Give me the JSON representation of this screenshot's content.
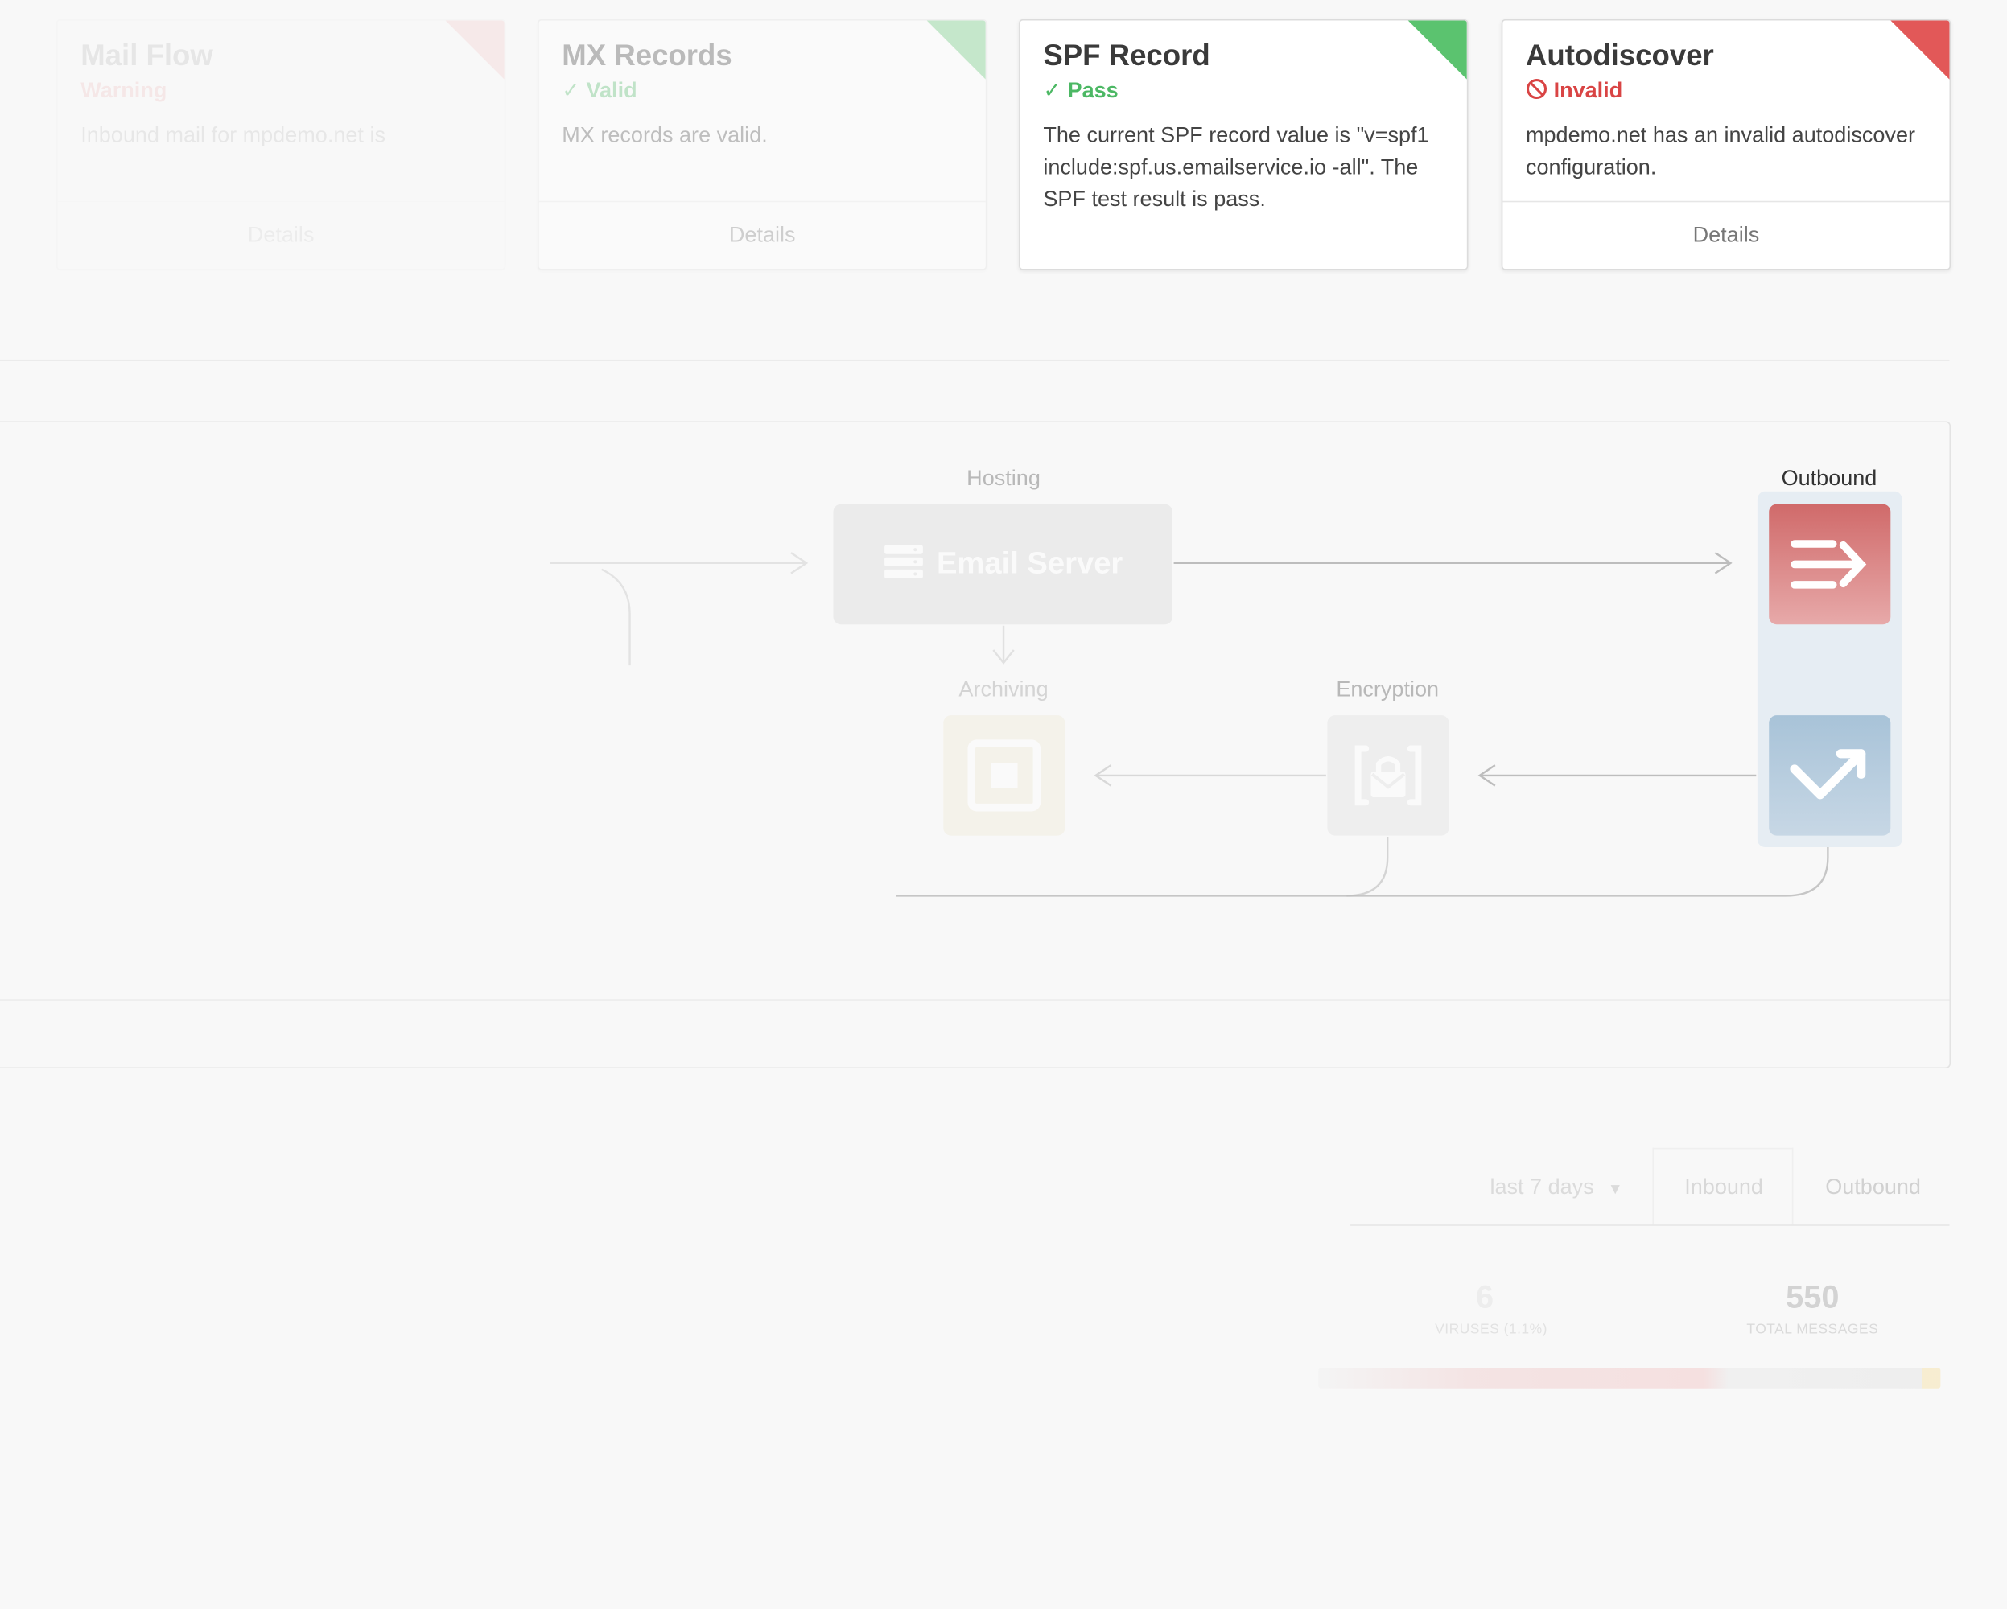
{
  "cards": {
    "mailflow": {
      "title": "Mail Flow",
      "status": "Warning",
      "desc": "Inbound mail for mpdemo.net is",
      "link": "Details"
    },
    "mx": {
      "title": "MX Records",
      "status": "Valid",
      "desc": "MX records are valid.",
      "link": "Details"
    },
    "spf": {
      "title": "SPF Record",
      "status": "Pass",
      "desc": "The current SPF record value is \"v=spf1 include:spf.us.emailservice.io -all\". The SPF test result is pass."
    },
    "autodiscover": {
      "title": "Autodiscover",
      "status": "Invalid",
      "desc": "mpdemo.net has an invalid autodiscover configuration.",
      "link": "Details"
    }
  },
  "flow": {
    "hosting_label": "Hosting",
    "server_label": "Email Server",
    "outbound_label": "Outbound",
    "archiving_label": "Archiving",
    "encryption_label": "Encryption"
  },
  "stats": {
    "period": "last 7 days",
    "tab_inbound": "Inbound",
    "tab_outbound": "Outbound",
    "viruses_value": "6",
    "viruses_label": "VIRUSES (1.1%)",
    "total_value": "550",
    "total_label": "TOTAL MESSAGES"
  },
  "colors": {
    "pass": "#4cb864",
    "fail": "#d94444",
    "outbound_accent": "#d06a6a",
    "check_accent": "#a8c3d8"
  }
}
